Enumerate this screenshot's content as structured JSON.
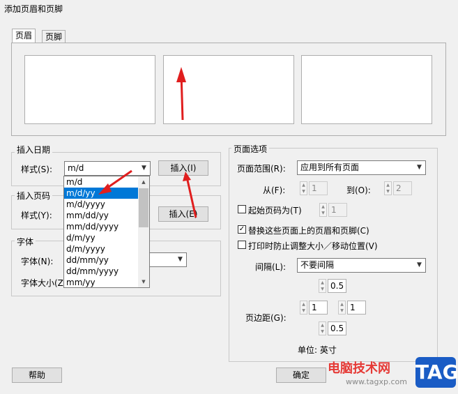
{
  "window": {
    "title": "添加页眉和页脚"
  },
  "tabs": [
    {
      "label": "页眉",
      "active": true
    },
    {
      "label": "页脚",
      "active": false
    }
  ],
  "insert_date": {
    "group_label": "插入日期",
    "style_label": "样式(S):",
    "style_value": "m/d",
    "insert_button": "插入(I)",
    "dropdown_options": [
      "m/d",
      "m/d/yy",
      "m/d/yyyy",
      "mm/dd/yy",
      "mm/dd/yyyy",
      "d/m/yy",
      "d/m/yyyy",
      "dd/mm/yy",
      "dd/mm/yyyy",
      "mm/yy"
    ],
    "selected_option": "m/d/yy"
  },
  "insert_page": {
    "group_label": "插入页码",
    "style_label": "样式(Y):",
    "insert_button": "插入(E)"
  },
  "font": {
    "group_label": "字体",
    "font_label": "字体(N):",
    "size_label": "字体大小(Z)"
  },
  "page_options": {
    "group_label": "页面选项",
    "range_label": "页面范围(R):",
    "range_value": "应用到所有页面",
    "from_label": "从(F):",
    "from_value": "1",
    "to_label": "到(O):",
    "to_value": "2",
    "start_page_label": "起始页码为(T)",
    "start_page_value": "1",
    "start_page_checked": false,
    "replace_label": "替换这些页面上的页眉和页脚(C)",
    "replace_checked": true,
    "prevent_resize_label": "打印时防止调整大小／移动位置(V)",
    "prevent_resize_checked": false,
    "spacing_label": "间隔(L):",
    "spacing_value": "不要间隔",
    "spacing_top": "0.5",
    "margin_label": "页边距(G):",
    "margin_left": "1",
    "margin_right": "1",
    "margin_bottom": "0.5",
    "unit_label": "单位: 英寸"
  },
  "buttons": {
    "help": "帮助",
    "ok": "确定"
  },
  "watermark": {
    "site_name": "电脑技术网",
    "url": "www.tagxp.com",
    "tag": "TAG"
  },
  "colors": {
    "selection": "#0078d7",
    "annotation_arrow": "#e01e1e",
    "tag_bg": "#1a5cc5"
  }
}
